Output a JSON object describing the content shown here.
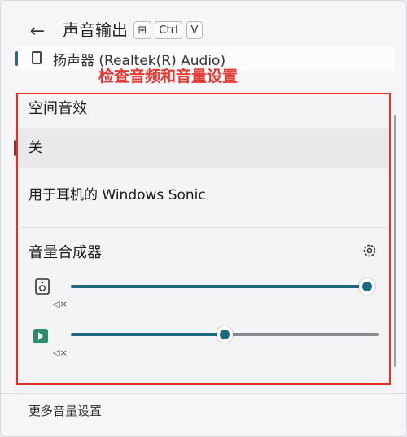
{
  "header": {
    "title": "声音输出",
    "shortcut_keys": [
      "⊞",
      "Ctrl",
      "V"
    ]
  },
  "device": {
    "label": "扬声器 (Realtek(R) Audio)"
  },
  "annotation": {
    "text": "检查音频和音量设置",
    "color": "#e23b36"
  },
  "spatial_audio": {
    "title": "空间音效",
    "options": [
      {
        "label": "关",
        "selected": true
      },
      {
        "label": "用于耳机的 Windows Sonic",
        "selected": false
      }
    ]
  },
  "mixer": {
    "title": "音量合成器",
    "settings_icon": "gear-icon",
    "rows": [
      {
        "icon": "speaker-device-icon",
        "mute_icon": "mute-icon",
        "level": 1.0
      },
      {
        "icon": "app-icon",
        "mute_icon": "mute-icon",
        "level": 0.5
      }
    ]
  },
  "footer": {
    "link": "更多音量设置"
  },
  "colors": {
    "accent": "#1e6880",
    "highlight_box": "#e0312b"
  }
}
